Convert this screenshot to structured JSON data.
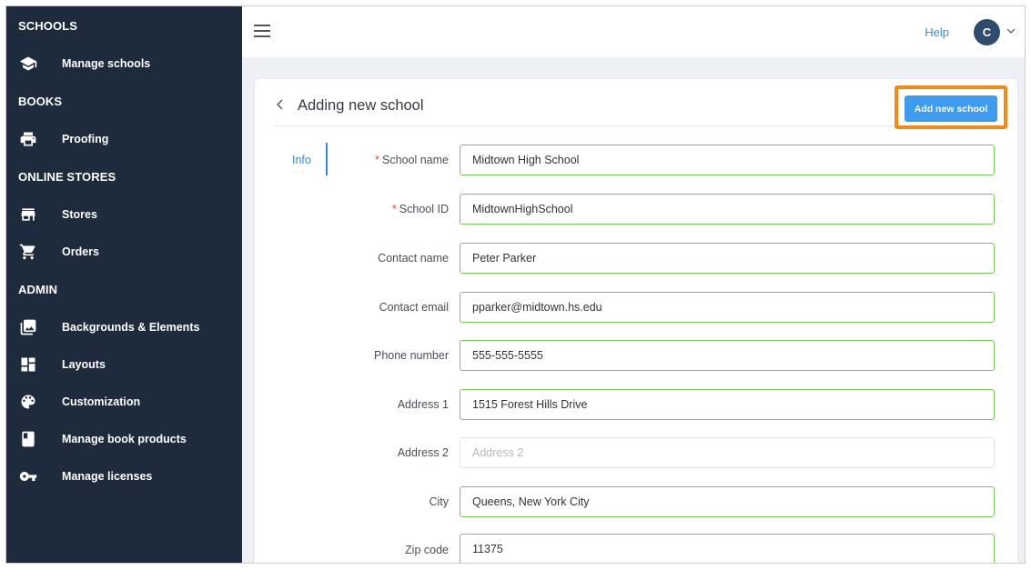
{
  "sidebar": {
    "sections": [
      {
        "title": "SCHOOLS"
      },
      {
        "title": "BOOKS"
      },
      {
        "title": "ONLINE STORES"
      },
      {
        "title": "ADMIN"
      }
    ],
    "items": [
      {
        "label": "Manage schools",
        "icon": "graduation-cap-icon"
      },
      {
        "label": "Proofing",
        "icon": "printer-icon"
      },
      {
        "label": "Stores",
        "icon": "store-icon"
      },
      {
        "label": "Orders",
        "icon": "cart-icon"
      },
      {
        "label": "Backgrounds & Elements",
        "icon": "images-icon"
      },
      {
        "label": "Layouts",
        "icon": "dashboard-icon"
      },
      {
        "label": "Customization",
        "icon": "palette-icon"
      },
      {
        "label": "Manage book products",
        "icon": "book-icon"
      },
      {
        "label": "Manage licenses",
        "icon": "key-icon"
      }
    ]
  },
  "topbar": {
    "help_label": "Help",
    "avatar_initial": "C"
  },
  "page": {
    "title": "Adding new school",
    "add_button_label": "Add new school",
    "tab_info": "Info"
  },
  "form": {
    "fields": [
      {
        "label": "School name",
        "required": true,
        "value": "Midtown High School",
        "placeholder": ""
      },
      {
        "label": "School ID",
        "required": true,
        "value": "MidtownHighSchool",
        "placeholder": ""
      },
      {
        "label": "Contact name",
        "required": false,
        "value": "Peter Parker",
        "placeholder": ""
      },
      {
        "label": "Contact email",
        "required": false,
        "value": "pparker@midtown.hs.edu",
        "placeholder": ""
      },
      {
        "label": "Phone number",
        "required": false,
        "value": "555-555-5555",
        "placeholder": ""
      },
      {
        "label": "Address 1",
        "required": false,
        "value": "1515 Forest Hills Drive",
        "placeholder": ""
      },
      {
        "label": "Address 2",
        "required": false,
        "value": "",
        "placeholder": "Address 2"
      },
      {
        "label": "City",
        "required": false,
        "value": "Queens, New York City",
        "placeholder": ""
      },
      {
        "label": "Zip code",
        "required": false,
        "value": "11375",
        "placeholder": ""
      }
    ],
    "required_marker": "*"
  },
  "colors": {
    "sidebar_bg": "#1e2b3c",
    "accent": "#2f8de4",
    "button": "#3d9bf0",
    "highlight": "#f28a14",
    "valid_border": "#7cc25a"
  }
}
